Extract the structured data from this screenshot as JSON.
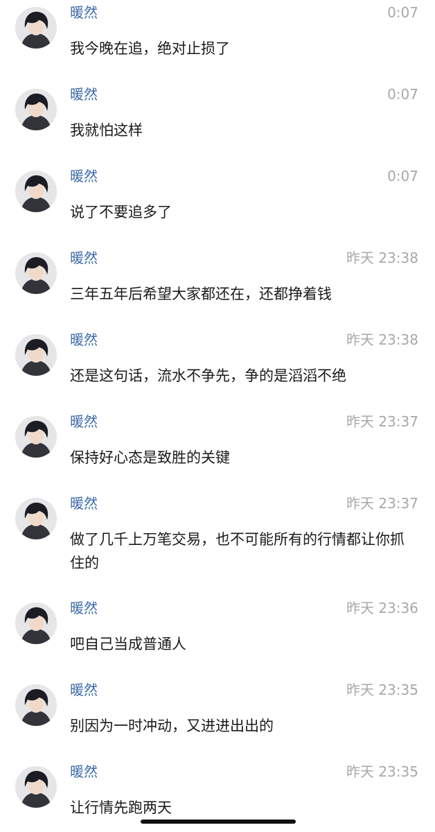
{
  "messages": [
    {
      "sender": "暖然",
      "time": "0:07",
      "text": "我今晚在追，绝对止损了"
    },
    {
      "sender": "暖然",
      "time": "0:07",
      "text": "我就怕这样"
    },
    {
      "sender": "暖然",
      "time": "0:07",
      "text": "说了不要追多了"
    },
    {
      "sender": "暖然",
      "time": "昨天 23:38",
      "text": "三年五年后希望大家都还在，还都挣着钱"
    },
    {
      "sender": "暖然",
      "time": "昨天 23:38",
      "text": "还是这句话，流水不争先，争的是滔滔不绝"
    },
    {
      "sender": "暖然",
      "time": "昨天 23:37",
      "text": "保持好心态是致胜的关键"
    },
    {
      "sender": "暖然",
      "time": "昨天 23:37",
      "text": "做了几千上万笔交易，也不可能所有的行情都让你抓住的"
    },
    {
      "sender": "暖然",
      "time": "昨天 23:36",
      "text": "吧自己当成普通人"
    },
    {
      "sender": "暖然",
      "time": "昨天 23:35",
      "text": "别因为一时冲动，又进进出出的"
    },
    {
      "sender": "暖然",
      "time": "昨天 23:35",
      "text": "让行情先跑两天"
    }
  ]
}
